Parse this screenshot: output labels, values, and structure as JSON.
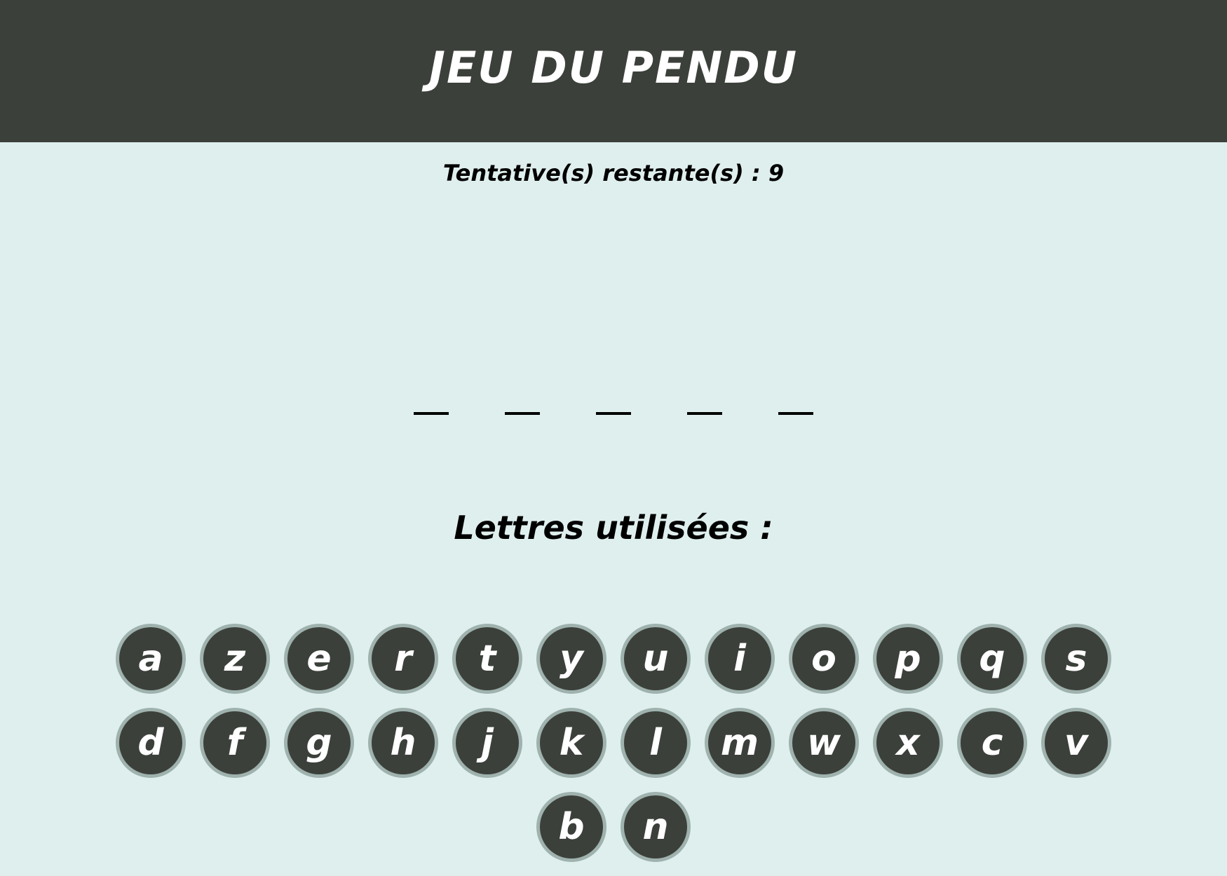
{
  "header": {
    "title": "JEU DU PENDU",
    "bg_color": "#3c403b"
  },
  "status": {
    "attempts_label": "Tentative(s) restante(s) :",
    "attempts_value": "9"
  },
  "word": {
    "length": 5,
    "revealed": [
      "",
      "",
      "",
      "",
      ""
    ]
  },
  "used_letters": {
    "title": "Lettres utilisées :",
    "letters": []
  },
  "keyboard": {
    "key_color": "#3c403b",
    "key_border_color": "#9fb2ae",
    "rows": [
      [
        "a",
        "z",
        "e",
        "r",
        "t",
        "y",
        "u",
        "i",
        "o",
        "p",
        "q",
        "s"
      ],
      [
        "d",
        "f",
        "g",
        "h",
        "j",
        "k",
        "l",
        "m",
        "w",
        "x",
        "c",
        "v"
      ],
      [
        "b",
        "n"
      ]
    ]
  },
  "page": {
    "background": "#dfefee"
  }
}
